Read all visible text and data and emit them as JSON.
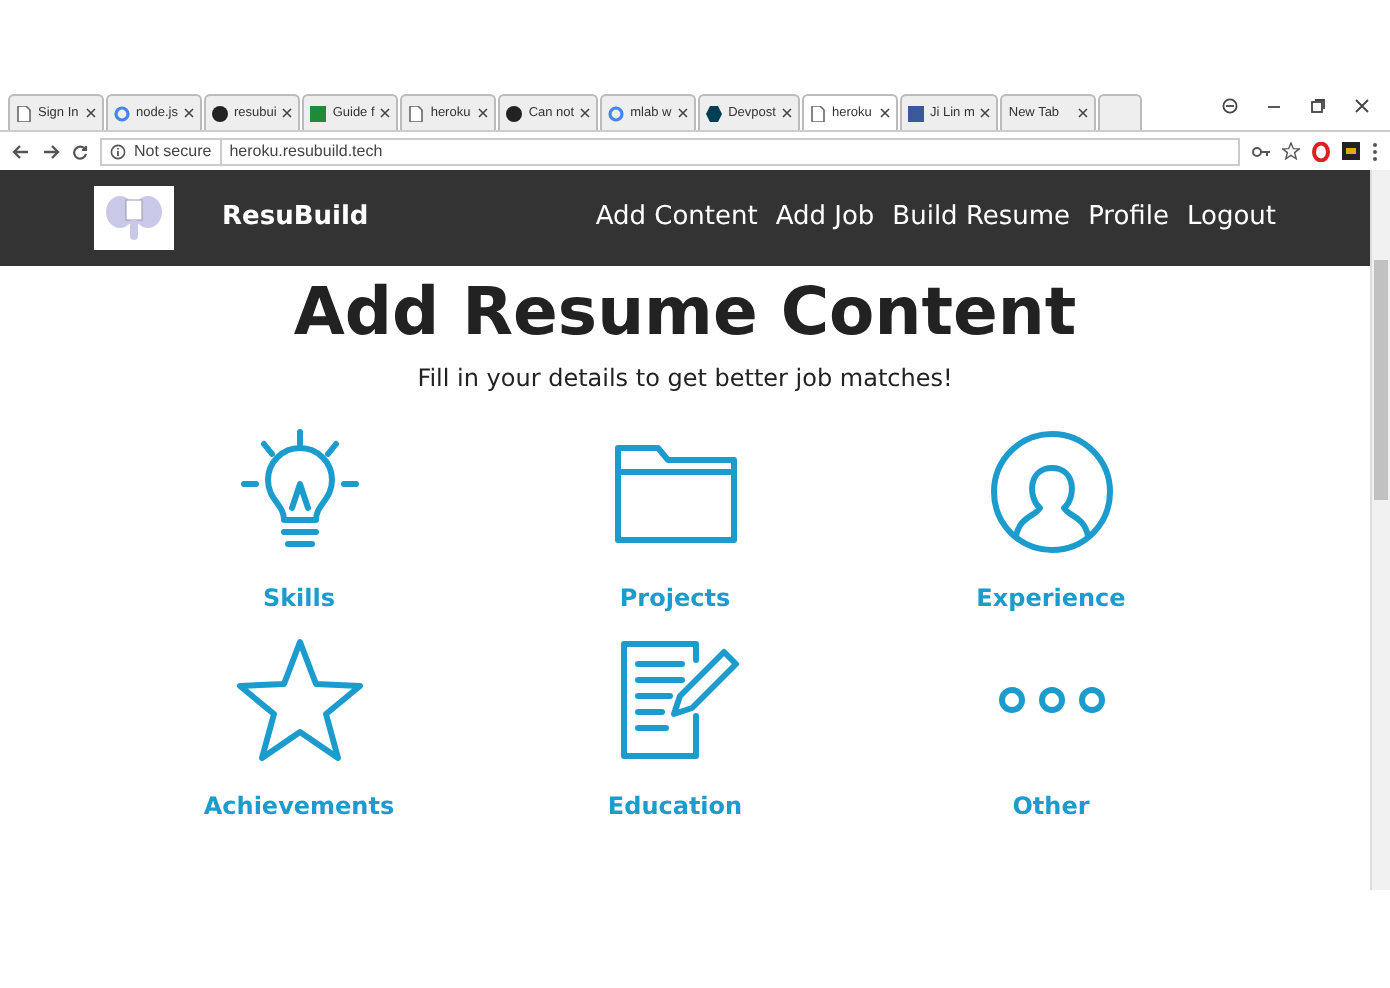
{
  "browser": {
    "tabs": [
      {
        "title": "Sign In",
        "kind": "page",
        "selected": false
      },
      {
        "title": "node.js",
        "kind": "google",
        "selected": false
      },
      {
        "title": "resubui",
        "kind": "github",
        "selected": false
      },
      {
        "title": "Guide f",
        "kind": "sheet",
        "selected": false
      },
      {
        "title": "heroku",
        "kind": "page",
        "selected": false
      },
      {
        "title": "Can not",
        "kind": "github",
        "selected": false
      },
      {
        "title": "mlab w",
        "kind": "google",
        "selected": false
      },
      {
        "title": "Devpost",
        "kind": "devpost",
        "selected": false
      },
      {
        "title": "heroku",
        "kind": "page",
        "selected": true
      },
      {
        "title": "Ji Lin m",
        "kind": "facebook",
        "selected": false
      },
      {
        "title": "New Tab",
        "kind": "blank",
        "selected": false
      }
    ],
    "security": "Not secure",
    "url": "heroku.resubuild.tech"
  },
  "navbar": {
    "brand": "ResuBuild",
    "links": [
      "Add Content",
      "Add Job",
      "Build Resume",
      "Profile",
      "Logout"
    ]
  },
  "heading": "Add Resume Content",
  "subtitle": "Fill in your details to get better job matches!",
  "categories": [
    {
      "label": "Skills",
      "kind": "bulb"
    },
    {
      "label": "Projects",
      "kind": "folder"
    },
    {
      "label": "Experience",
      "kind": "person"
    },
    {
      "label": "Achievements",
      "kind": "star"
    },
    {
      "label": "Education",
      "kind": "document"
    },
    {
      "label": "Other",
      "kind": "dots"
    }
  ]
}
